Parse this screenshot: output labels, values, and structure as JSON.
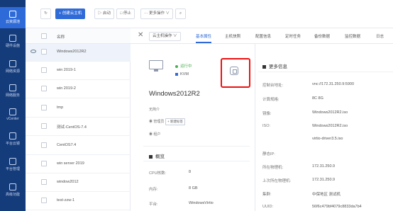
{
  "nav": {
    "items": [
      {
        "label": "云资源池",
        "active": true
      },
      {
        "label": "硬件设施",
        "active": false
      },
      {
        "label": "网络资源",
        "active": false
      },
      {
        "label": "网络服务",
        "active": false
      },
      {
        "label": "vCenter",
        "active": false
      },
      {
        "label": "平台云镜",
        "active": false
      },
      {
        "label": "平台管理",
        "active": false
      },
      {
        "label": "高级功能",
        "active": false
      }
    ]
  },
  "toolbar": {
    "create_label": "+ 创建云主机",
    "start_label": "▷ 启动",
    "stop_label": "□ 停止",
    "more_label": "··· 更多操作 ∨"
  },
  "list": {
    "header": "名称",
    "rows": [
      {
        "name": "Windows2012R2",
        "selected": true
      },
      {
        "name": "win 2019-1",
        "selected": false
      },
      {
        "name": "win 2019-2",
        "selected": false
      },
      {
        "name": "tmp",
        "selected": false
      },
      {
        "name": "测试-CentOS-7.4",
        "selected": false
      },
      {
        "name": "CentOS7.4",
        "selected": false
      },
      {
        "name": "win server 2019",
        "selected": false
      },
      {
        "name": "window2012",
        "selected": false
      },
      {
        "name": "test-zzw-1",
        "selected": false
      }
    ]
  },
  "detail": {
    "ops_label": "云主机操作 ∨",
    "tabs": [
      "基本属性",
      "主机快照",
      "配置信息",
      "定时任务",
      "备份数据",
      "监控数据",
      "日志"
    ],
    "status": "运行中",
    "hypervisor": "KVM",
    "vm_name": "Windows2012R2",
    "desc_label": "无简介",
    "admin_label": "管理员",
    "tag_label": "+ 新建标签",
    "tenant_label": "租户",
    "overview": {
      "title": "概览",
      "items": [
        {
          "key": "CPU核数:",
          "value": "8"
        },
        {
          "key": "内存:",
          "value": "8 GB"
        },
        {
          "key": "平台:",
          "value": "WindowsVirtio"
        }
      ]
    },
    "more_info": {
      "title": "更多信息",
      "items": [
        {
          "key": "控制台地址:",
          "value": "vnc://172.31.250.9:5900"
        },
        {
          "key": "计算规格:",
          "value": "8C 8G"
        },
        {
          "key": "镜像:",
          "value": "Windows2012R2.iso"
        },
        {
          "key": "ISO:",
          "value": "Windows2012R2.iso"
        },
        {
          "key": "",
          "value": "virtio-driver3.5.iso"
        },
        {
          "key": "静态IP:",
          "value": ""
        },
        {
          "key": "所在物理机:",
          "value": "172.31.250.9"
        },
        {
          "key": "上次所在物理机:",
          "value": "172.31.250.9"
        },
        {
          "key": "集群:",
          "value": "中保地区 测试机"
        },
        {
          "key": "UUID:",
          "value": "56f6c479bf4079c8833da7b4"
        }
      ]
    }
  },
  "colors": {
    "nav_bg": "#143b7a",
    "accent": "#2f6bd8",
    "highlight": "#e11111",
    "running": "#4caf50"
  }
}
